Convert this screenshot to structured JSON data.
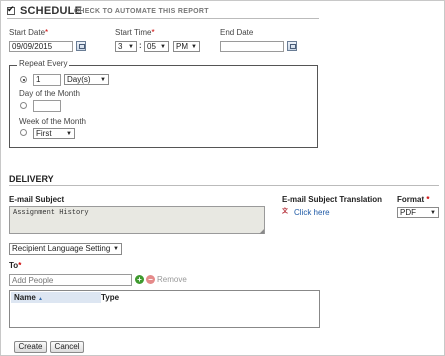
{
  "schedule": {
    "title": "SCHEDULE",
    "subtitle": "CHECK TO AUTOMATE THIS REPORT",
    "checked": true,
    "start_date_label": "Start Date",
    "start_date_value": "09/09/2015",
    "start_time_label": "Start Time",
    "hour": "3",
    "time_sep": ":",
    "minute": "05",
    "ampm": "PM",
    "end_date_label": "End Date",
    "end_date_value": "",
    "required_mark": "*"
  },
  "repeat": {
    "legend": "Repeat Every",
    "interval_value": "1",
    "interval_unit": "Day(s)",
    "day_of_month_label": "Day of the Month",
    "day_of_month_value": "",
    "week_of_month_label": "Week of the Month",
    "week_of_month_value": "First"
  },
  "delivery": {
    "title": "DELIVERY",
    "email_subject_label": "E-mail Subject",
    "email_subject_value": "Assignment History",
    "translation_label": "E-mail Subject Translation",
    "translation_link": "Click here",
    "format_label": "Format",
    "format_value": "PDF",
    "recipient_language": "Recipient Language Setting",
    "to_label": "To",
    "add_people_placeholder": "Add People",
    "remove_label": "Remove",
    "table_headers": {
      "name": "Name",
      "type": "Type"
    }
  },
  "actions": {
    "create": "Create",
    "cancel": "Cancel"
  }
}
